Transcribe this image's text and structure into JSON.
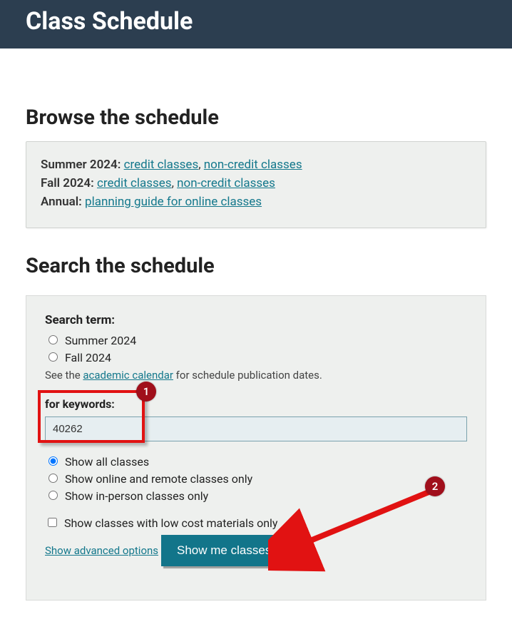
{
  "header": {
    "title": "Class Schedule"
  },
  "browse": {
    "heading": "Browse the schedule",
    "lines": [
      {
        "label": "Summer 2024:",
        "link1": "credit classes",
        "sep": ", ",
        "link2": "non-credit classes"
      },
      {
        "label": "Fall 2024:",
        "link1": "credit classes",
        "sep": ", ",
        "link2": "non-credit classes"
      },
      {
        "label": "Annual:",
        "link1": "planning guide for online classes",
        "sep": "",
        "link2": ""
      }
    ]
  },
  "search": {
    "heading": "Search the schedule",
    "term_label": "Search term:",
    "terms": [
      "Summer 2024",
      "Fall 2024"
    ],
    "hint_before": "See the ",
    "hint_link": "academic calendar",
    "hint_after": " for schedule publication dates.",
    "keywords_label": "for keywords:",
    "keywords_value": "40262",
    "display_options": [
      "Show all classes",
      "Show online and remote classes only",
      "Show in-person classes only"
    ],
    "display_selected_index": 0,
    "lowcost_label": "Show classes with low cost materials only",
    "advanced_label": "Show advanced options",
    "submit_label": "Show me classes"
  },
  "annotations": {
    "badge1": "1",
    "badge2": "2"
  }
}
